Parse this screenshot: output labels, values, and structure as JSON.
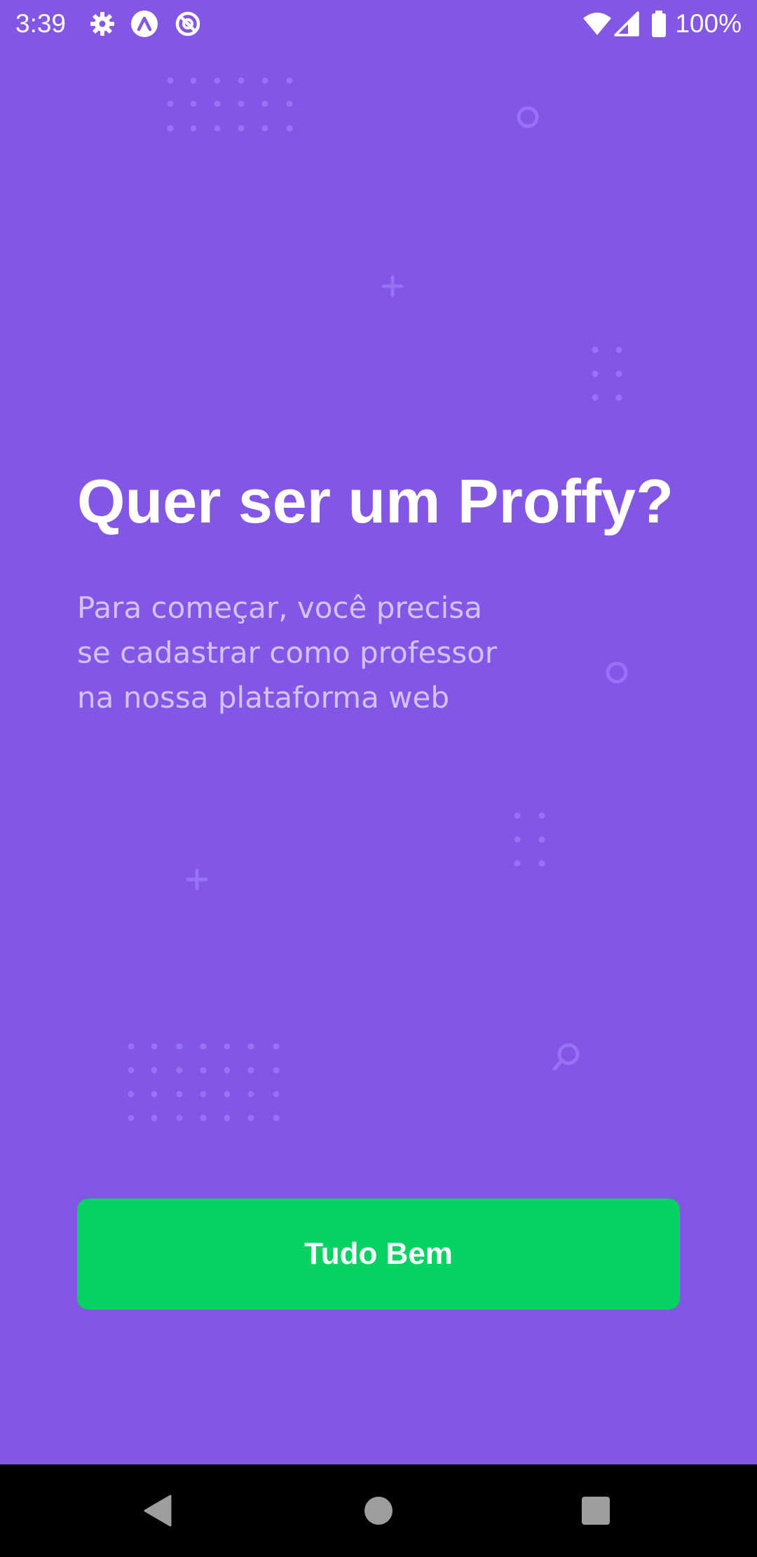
{
  "status_bar": {
    "time": "3:39",
    "battery_text": "100%",
    "icons": [
      "gear-icon",
      "app-logo-icon",
      "no-sync-icon",
      "wifi-icon",
      "cell-signal-icon",
      "battery-icon"
    ]
  },
  "main": {
    "title": "Quer ser um Proffy?",
    "description_lines": [
      "Para começar, você precisa",
      "se cadastrar como professor",
      "na nossa plataforma web"
    ],
    "button_label": "Tudo Bem"
  },
  "nav_bar": {
    "icons": [
      "back-icon",
      "home-icon",
      "recents-icon"
    ]
  },
  "colors": {
    "background": "#8257E5",
    "title": "#FFFFFF",
    "description": "#D4C2FF",
    "button": "#04D361",
    "button_text": "#FFFFFF",
    "decoration": "#9871F5",
    "nav_bar": "#000000"
  }
}
